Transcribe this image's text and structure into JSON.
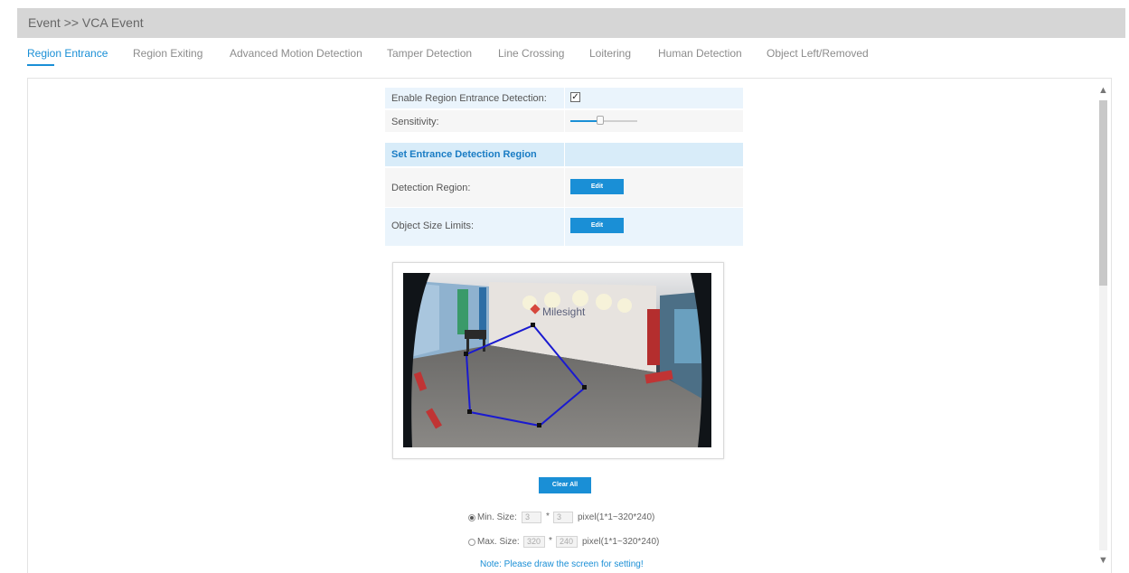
{
  "header": {
    "title": "Event >> VCA Event"
  },
  "tabs": [
    {
      "label": "Region Entrance",
      "active": true
    },
    {
      "label": "Region Exiting",
      "active": false
    },
    {
      "label": "Advanced Motion Detection",
      "active": false
    },
    {
      "label": "Tamper Detection",
      "active": false
    },
    {
      "label": "Line Crossing",
      "active": false
    },
    {
      "label": "Loitering",
      "active": false
    },
    {
      "label": "Human Detection",
      "active": false
    },
    {
      "label": "Object Left/Removed",
      "active": false
    }
  ],
  "settings": {
    "enable_label": "Enable Region Entrance Detection:",
    "enable_checked": true,
    "enable_mark": "✓",
    "sensitivity_label": "Sensitivity:",
    "sensitivity_value": 0.45,
    "section_title": "Set Entrance Detection Region",
    "detection_region_label": "Detection Region:",
    "detection_region_button": "Edit",
    "object_size_label": "Object Size Limits:",
    "object_size_button": "Edit"
  },
  "preview": {
    "logo_text": "Milesight"
  },
  "clear_all_button": "Clear All",
  "min_size": {
    "label": "Min. Size:",
    "width": "3",
    "height": "3",
    "separator": "*",
    "unit": "pixel(1*1~320*240)",
    "selected": true
  },
  "max_size": {
    "label": "Max. Size:",
    "width": "320",
    "height": "240",
    "separator": "*",
    "unit": "pixel(1*1~320*240)",
    "selected": false
  },
  "note": "Note: Please draw the screen for setting!",
  "scrollbar": {
    "up_icon": "▲",
    "down_icon": "▼"
  },
  "colors": {
    "accent": "#1a8fd6",
    "header_bg": "#d6d6d6",
    "section_bg": "#d8ecf9",
    "polygon": "#1a1ad0"
  }
}
